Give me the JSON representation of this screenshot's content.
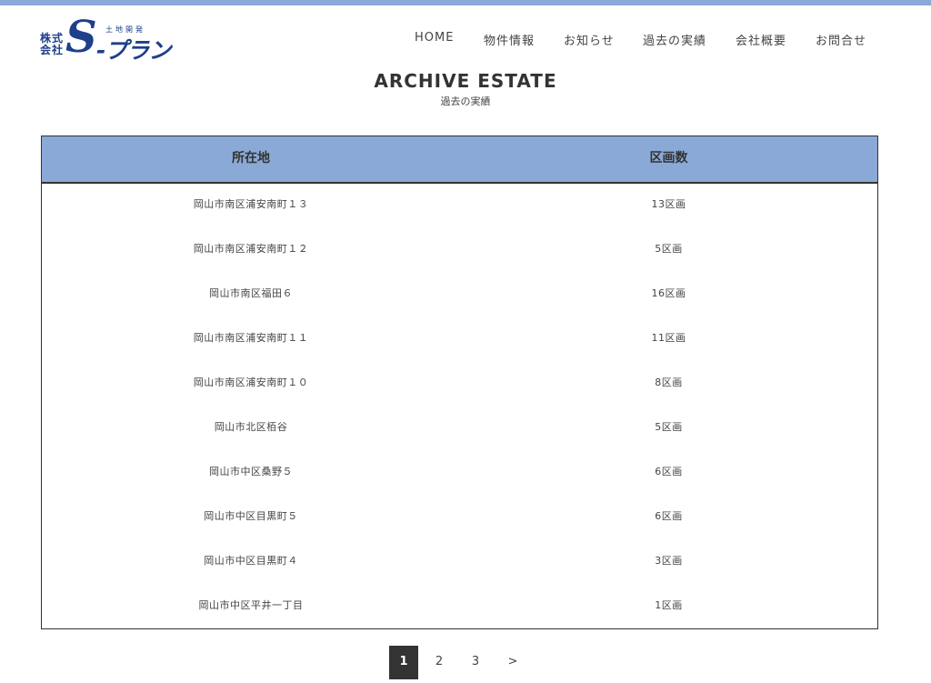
{
  "header": {
    "logo": {
      "kabushiki_line1": "株式",
      "kabushiki_line2": "会社",
      "tochi_kaihatsu": "土地開発",
      "s_letter": "S",
      "plan": "-プラン"
    },
    "nav": [
      {
        "label": "HOME"
      },
      {
        "label": "物件情報"
      },
      {
        "label": "お知らせ"
      },
      {
        "label": "過去の実績"
      },
      {
        "label": "会社概要"
      },
      {
        "label": "お問合せ"
      }
    ]
  },
  "main": {
    "title": "ARCHIVE ESTATE",
    "subtitle": "過去の実績",
    "table": {
      "columns": [
        "所在地",
        "区画数"
      ],
      "rows": [
        {
          "location": "岡山市南区浦安南町１３",
          "lots": "13区画"
        },
        {
          "location": "岡山市南区浦安南町１２",
          "lots": "5区画"
        },
        {
          "location": "岡山市南区福田６",
          "lots": "16区画"
        },
        {
          "location": "岡山市南区浦安南町１１",
          "lots": "11区画"
        },
        {
          "location": "岡山市南区浦安南町１０",
          "lots": "8区画"
        },
        {
          "location": "岡山市北区栢谷",
          "lots": "5区画"
        },
        {
          "location": "岡山市中区桑野５",
          "lots": "6区画"
        },
        {
          "location": "岡山市中区目黒町５",
          "lots": "6区画"
        },
        {
          "location": "岡山市中区目黒町４",
          "lots": "3区画"
        },
        {
          "location": "岡山市中区平井一丁目",
          "lots": "1区画"
        }
      ]
    },
    "pagination": {
      "pages": [
        "1",
        "2",
        "3"
      ],
      "next": ">",
      "current": "1"
    }
  },
  "colors": {
    "accent": "#8aa9d6",
    "logo": "#1e3f8a",
    "active_page": "#333333"
  }
}
